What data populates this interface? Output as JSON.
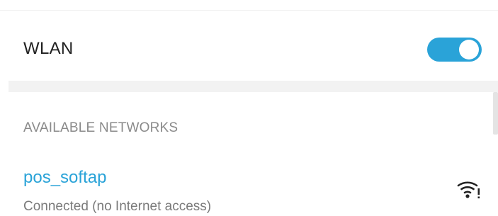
{
  "wlan": {
    "label": "WLAN",
    "enabled": true,
    "toggle_color": "#2aa3d8"
  },
  "available_networks": {
    "header": "AVAILABLE NETWORKS",
    "items": [
      {
        "name": "pos_softap",
        "status": "Connected (no Internet access)",
        "icon": "wifi-signal-no-internet-icon",
        "name_color": "#2aa3d8"
      }
    ]
  }
}
